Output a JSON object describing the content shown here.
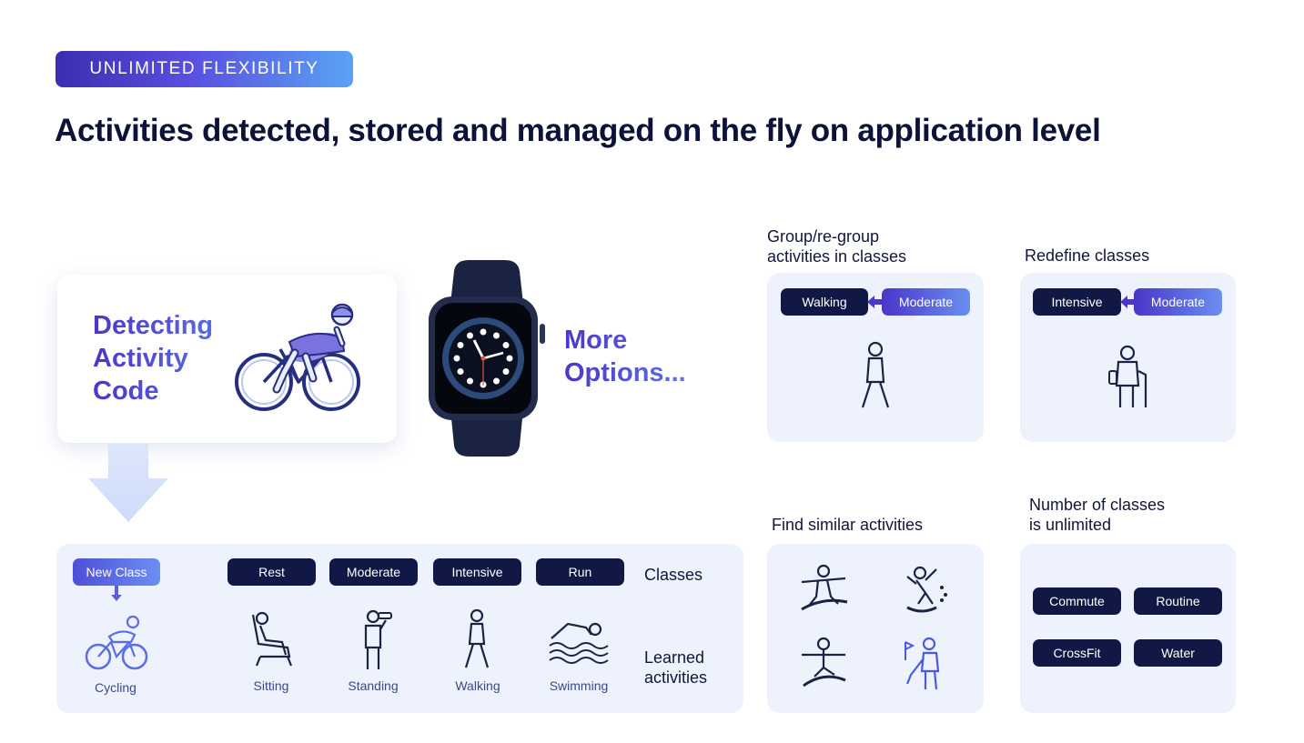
{
  "badge": "UNLIMITED FLEXIBILITY",
  "title": "Activities detected, stored and managed on the fly on application level",
  "detect": {
    "line1": "Detecting",
    "line2": "Activity",
    "line3": "Code"
  },
  "more": {
    "line1": "More",
    "line2": "Options..."
  },
  "classes_panel": {
    "new_class": "New Class",
    "classes": [
      "Rest",
      "Moderate",
      "Intensive",
      "Run"
    ],
    "classes_label": "Classes",
    "activities": [
      "Cycling",
      "Sitting",
      "Standing",
      "Walking",
      "Swimming"
    ],
    "activities_label_1": "Learned",
    "activities_label_2": "activities"
  },
  "group_panel": {
    "label_1": "Group/re-group",
    "label_2": "activities in classes",
    "left_pill": "Walking",
    "right_pill": "Moderate"
  },
  "redefine_panel": {
    "label": "Redefine classes",
    "left_pill": "Intensive",
    "right_pill": "Moderate"
  },
  "similar_panel": {
    "label": "Find similar activities"
  },
  "unlimited_panel": {
    "label_1": "Number of classes",
    "label_2": "is unlimited",
    "pills": [
      "Commute",
      "Routine",
      "CrossFit",
      "Water"
    ]
  },
  "colors": {
    "navy": "#111845",
    "accent_purple": "#4a36c8",
    "accent_blue": "#6a8ff0",
    "panel_bg": "#eef2fc"
  },
  "icons": [
    "cyclist-icon",
    "watch-image",
    "down-arrow-icon",
    "walker-icon",
    "elderly-icon",
    "snowboarder-icon",
    "skater-icon",
    "golfer-icon",
    "sitting-icon",
    "standing-icon",
    "swimmer-icon"
  ]
}
